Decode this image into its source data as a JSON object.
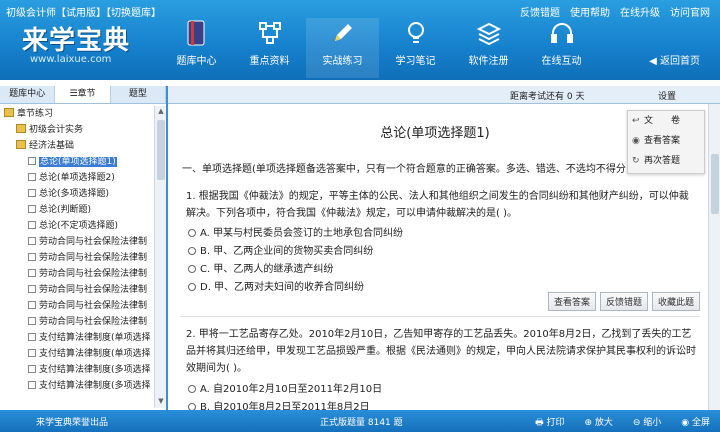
{
  "app": {
    "title": "初级会计师【试用版】【切换题库】",
    "top_links": [
      "反馈错题",
      "使用帮助",
      "在线升级",
      "访问官网"
    ],
    "logo": "来学宝典",
    "logo_sub": "www.laixue.com",
    "back_home": "◀ 返回首页"
  },
  "nav": [
    {
      "label": "题库中心",
      "icon": "book-icon"
    },
    {
      "label": "重点资料",
      "icon": "network-icon"
    },
    {
      "label": "实战练习",
      "icon": "pencil-icon"
    },
    {
      "label": "学习笔记",
      "icon": "bulb-icon"
    },
    {
      "label": "软件注册",
      "icon": "stack-icon"
    },
    {
      "label": "在线互动",
      "icon": "headset-icon"
    }
  ],
  "subbar": {
    "countdown": "距离考试还有 0 天",
    "settings": "设置"
  },
  "left_tabs": [
    "题库中心",
    "☰章节",
    "题型"
  ],
  "tree": [
    {
      "label": "章节练习",
      "level": 0,
      "type": "folder"
    },
    {
      "label": "初级会计实务",
      "level": 1,
      "type": "folder"
    },
    {
      "label": "经济法基础",
      "level": 1,
      "type": "folder"
    },
    {
      "label": "总论(单项选择题1)",
      "level": 2,
      "type": "item",
      "selected": true
    },
    {
      "label": "总论(单项选择题2)",
      "level": 2,
      "type": "item"
    },
    {
      "label": "总论(多项选择题)",
      "level": 2,
      "type": "item"
    },
    {
      "label": "总论(判断题)",
      "level": 2,
      "type": "item"
    },
    {
      "label": "总论(不定项选择题)",
      "level": 2,
      "type": "item"
    },
    {
      "label": "劳动合同与社会保险法律制",
      "level": 2,
      "type": "item"
    },
    {
      "label": "劳动合同与社会保险法律制",
      "level": 2,
      "type": "item"
    },
    {
      "label": "劳动合同与社会保险法律制",
      "level": 2,
      "type": "item"
    },
    {
      "label": "劳动合同与社会保险法律制",
      "level": 2,
      "type": "item"
    },
    {
      "label": "劳动合同与社会保险法律制",
      "level": 2,
      "type": "item"
    },
    {
      "label": "劳动合同与社会保险法律制",
      "level": 2,
      "type": "item"
    },
    {
      "label": "支付结算法律制度(单项选择",
      "level": 2,
      "type": "item"
    },
    {
      "label": "支付结算法律制度(单项选择",
      "level": 2,
      "type": "item"
    },
    {
      "label": "支付结算法律制度(多项选择",
      "level": 2,
      "type": "item"
    },
    {
      "label": "支付结算法律制度(多项选择",
      "level": 2,
      "type": "item"
    }
  ],
  "main": {
    "title": "总论(单项选择题1)",
    "intro": "一、单项选择题(单项选择题备选答案中，只有一个符合题意的正确答案。多选、错选、不选均不得分",
    "q1": {
      "text": "1. 根据我国《仲裁法》的规定，平等主体的公民、法人和其他组织之间发生的合同纠纷和其他财产纠纷，可以仲裁解决。下列各项中，符合我国《仲裁法》规定，可以申请仲裁解决的是( )。",
      "options": [
        "A. 甲某与村民委员会签订的土地承包合同纠纷",
        "B. 甲、乙两企业间的货物买卖合同纠纷",
        "C. 甲、乙两人的继承遗产纠纷",
        "D. 甲、乙两对夫妇间的收养合同纠纷"
      ]
    },
    "buttons": [
      "查看答案",
      "反馈错题",
      "收藏此题"
    ],
    "q2": {
      "text": "2. 甲将一工艺品寄存乙处。2010年2月10日，乙告知甲寄存的工艺品丢失。2010年8月2日，乙找到了丢失的工艺品并将其归还给甲，甲发现工艺品损毁严重。根据《民法通则》的规定，甲向人民法院请求保护其民事权利的诉讼时效期间为( )。",
      "options": [
        "A. 自2010年2月10日至2011年2月10日",
        "B. 自2010年8月2日至2011年8月2日"
      ]
    }
  },
  "float_menu": [
    {
      "label": "文　　卷",
      "icon": "undo-icon"
    },
    {
      "label": "查看答案",
      "icon": "eye-icon"
    },
    {
      "label": "再次答题",
      "icon": "redo-icon"
    }
  ],
  "status": {
    "publisher": "来学宝典荣誉出品",
    "count": "正式版题量 8141 题",
    "tools": [
      "🖶 打印",
      "⊕ 放大",
      "⊖ 缩小",
      "◉ 全屏"
    ]
  }
}
